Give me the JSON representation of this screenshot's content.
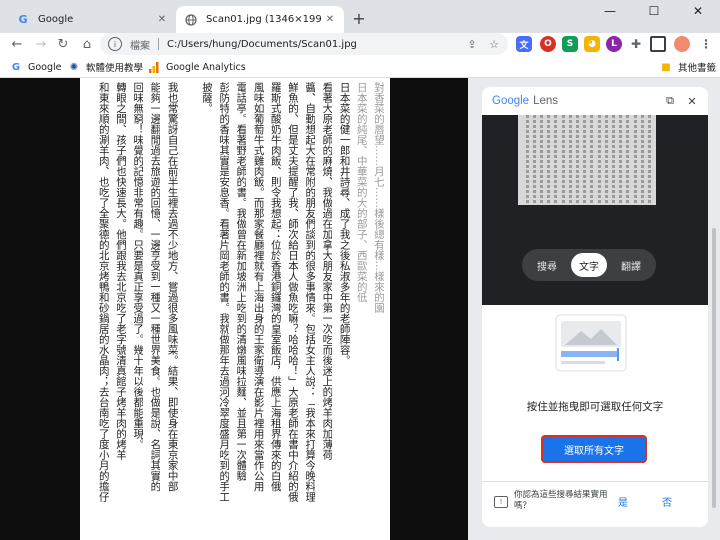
{
  "browser": {
    "tabs": [
      {
        "title": "Google",
        "favicon": "google-g-icon",
        "active": false
      },
      {
        "title": "Scan01.jpg (1346×1992)",
        "favicon": "globe-icon",
        "active": true
      }
    ],
    "omnibox": {
      "site_label": "檔案",
      "url": "C:/Users/hung/Documents/Scan01.jpg"
    },
    "bookmarks": [
      {
        "label": "Google",
        "icon": "google-g-icon"
      },
      {
        "label": "軟體使用教學",
        "icon": "sun-badge-icon"
      },
      {
        "label": "Google Analytics",
        "icon": "analytics-icon"
      }
    ],
    "other_bookmarks": "其他書籤"
  },
  "document": {
    "columns": [
      "對香菜的唇望……月七……樣後總有樣…樣來的園",
      "日本菜的純尾、中華菜的大的部子、西歐菜的低",
      "日本菜的健一郎和井詩尋、成了我之後私淑多年的老師陣容。",
      "看著大原老師的麻燒、我做過在加拿大朋友家中第一次吃而後迷上的烤羊肉加薄荷",
      "醬、自動想起大在常附的朋友們談到的很多事情來。包括女主人說：「我本來打算今晚料理",
      "鮮魚的、但是丈夫提醒了我、師次給日本人做魚吃嘛？哈哈哈！」大原老師在書中介紹的俄",
      "羅斯式酸奶牛肉飯、則令我想起：位於香港銅鑼灣的皇室飯店，供應上海租界傳來的白俄",
      "風味如葡萄牛式雞肉飯。而那家餐廳裡就有上海出身的王家衛導演在影片裡用來當作公用",
      "電話亭。看著野老師的書。我做曾在新加坡洲上吃到的清燉風味拉麵、並且第一次體驗",
      "彭防特的香味其實是安息香。看著片岡老師的書。我就做那年去過河冷翠度盛月吃到的手工",
      "披薩。",
      "",
      "我也常驚訝自己在前半生裡去過不少地方、嘗過很多風味菜。結果、即使身在東京家中部",
      "能夠一邊翻閒過去旅遊的回憶、一邊亨受到一種又一種世界美食。也做是說、名詞其實的",
      "回味無窮！味覺的記憶非常有趣。只要是真正享受過了。幾十年以後都能重現。",
      "轉眼之間、孩子們也快速長大。他們跟我去北京吃了老字號清真館子烤羊肉的烤羊",
      "和東來順的涮羊肉、也吃了全聚德的北京烤鴨和砂鍋居的水晶肉；去台南吃了度小月的擔仔"
    ]
  },
  "lens": {
    "title_google": "Google",
    "title_lens": "Lens",
    "modes": [
      "搜尋",
      "文字",
      "翻譯"
    ],
    "active_mode": "文字",
    "prompt": "按住並拖曳即可選取任何文字",
    "select_all_label": "選取所有文字",
    "feedback_question": "你認為這些搜尋結果實用嗎？",
    "feedback_yes": "是",
    "feedback_no": "否",
    "accent_color": "#1a73e8",
    "highlight_border": "#d93025"
  }
}
